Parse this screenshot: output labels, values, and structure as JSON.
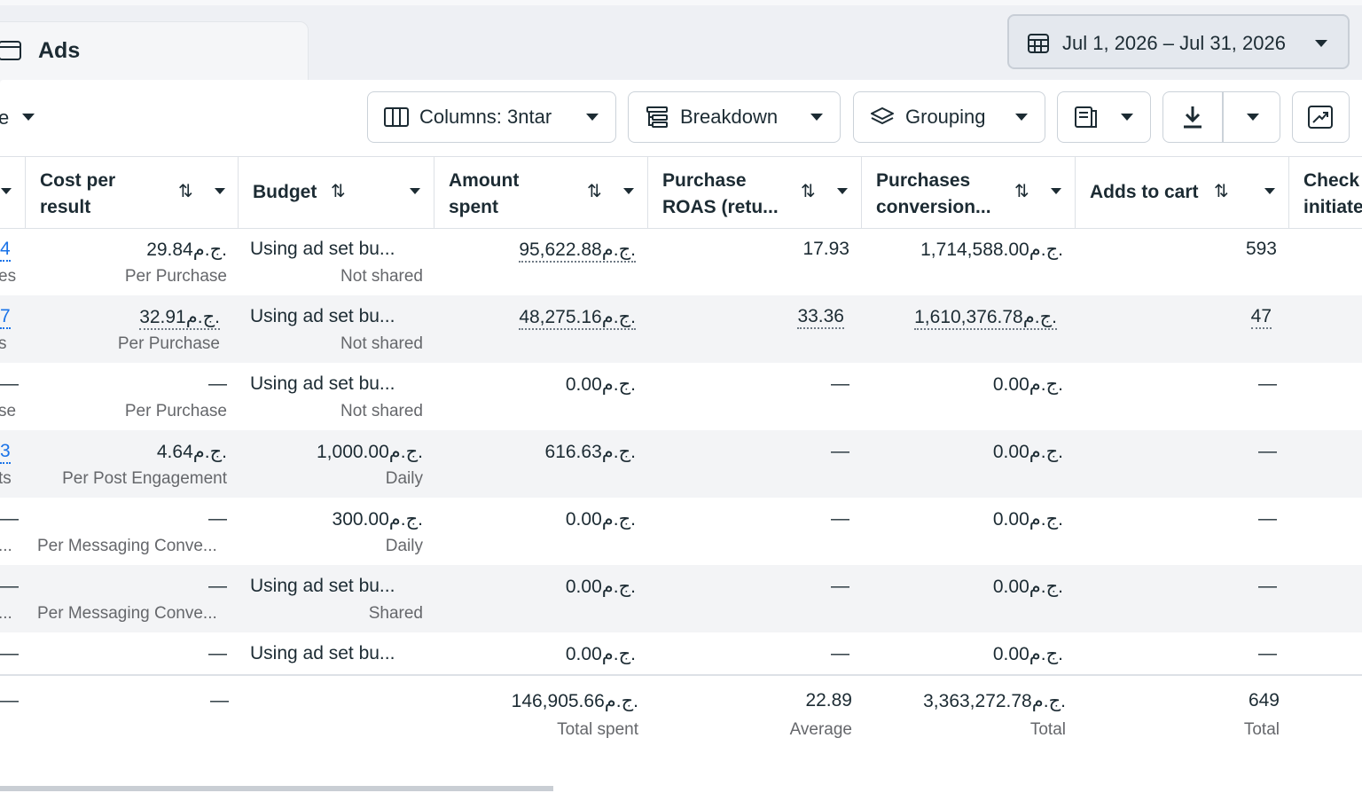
{
  "app": {
    "tab_title": "Ads"
  },
  "date_range": {
    "label": "Jul 1, 2026 – Jul 31, 2026"
  },
  "toolbar": {
    "left_fragment": "e",
    "columns_label": "Columns: 3ntar",
    "breakdown_label": "Breakdown",
    "grouping_label": "Grouping"
  },
  "table": {
    "headers": {
      "cost_per_result": [
        "Cost per",
        "result"
      ],
      "budget": "Budget",
      "amount_spent": [
        "Amount",
        "spent"
      ],
      "purchase_roas": [
        "Purchase",
        "ROAS (retu..."
      ],
      "purchases_conversion": [
        "Purchases",
        "conversion..."
      ],
      "adds_to_cart": "Adds to cart",
      "checkouts": [
        "Check",
        "initiate"
      ]
    },
    "rows": [
      {
        "left_val": "4",
        "left_sub": "es",
        "cost": "29.84ج.م.",
        "cost_sub": "Per Purchase",
        "budget": "Using ad set bu...",
        "budget_sub": "Not shared",
        "amount": "95,622.88ج.م.",
        "roas": "17.93",
        "conv": "1,714,588.00ج.م.",
        "cart": "593"
      },
      {
        "left_val": "7",
        "left_sub": "s",
        "cost": "32.91ج.م.",
        "cost_sub": "Per Purchase",
        "budget": "Using ad set bu...",
        "budget_sub": "Not shared",
        "amount": "48,275.16ج.م.",
        "roas": "33.36",
        "conv": "1,610,376.78ج.م.",
        "cart": "47"
      },
      {
        "left_val": "—",
        "left_sub": "se",
        "cost": "—",
        "cost_sub": "Per Purchase",
        "budget": "Using ad set bu...",
        "budget_sub": "Not shared",
        "amount": "0.00ج.م.",
        "roas": "—",
        "conv": "0.00ج.م.",
        "cart": "—"
      },
      {
        "left_val": "3",
        "left_sub": "ts",
        "cost": "4.64ج.م.",
        "cost_sub": "Per Post Engagement",
        "budget": "1,000.00ج.م.",
        "budget_sub": "Daily",
        "amount": "616.63ج.م.",
        "roas": "—",
        "conv": "0.00ج.م.",
        "cart": "—"
      },
      {
        "left_val": "—",
        "left_sub": "...",
        "cost": "—",
        "cost_sub": "Per Messaging Conve...",
        "budget": "300.00ج.م.",
        "budget_sub": "Daily",
        "amount": "0.00ج.م.",
        "roas": "—",
        "conv": "0.00ج.م.",
        "cart": "—"
      },
      {
        "left_val": "—",
        "left_sub": "...",
        "cost": "—",
        "cost_sub": "Per Messaging Conve...",
        "budget": "Using ad set bu...",
        "budget_sub": "Shared",
        "amount": "0.00ج.م.",
        "roas": "—",
        "conv": "0.00ج.م.",
        "cart": "—"
      },
      {
        "left_val": "—",
        "left_sub": "",
        "cost": "—",
        "cost_sub": "",
        "budget": "Using ad set bu...",
        "budget_sub": "",
        "amount": "0.00ج.م.",
        "roas": "—",
        "conv": "0.00ج.م.",
        "cart": "—"
      }
    ],
    "totals": {
      "left_val": "—",
      "cost": "—",
      "amount": "146,905.66ج.م.",
      "amount_sub": "Total spent",
      "roas": "22.89",
      "roas_sub": "Average",
      "conv": "3,363,272.78ج.م.",
      "conv_sub": "Total",
      "cart": "649",
      "cart_sub": "Total"
    }
  }
}
